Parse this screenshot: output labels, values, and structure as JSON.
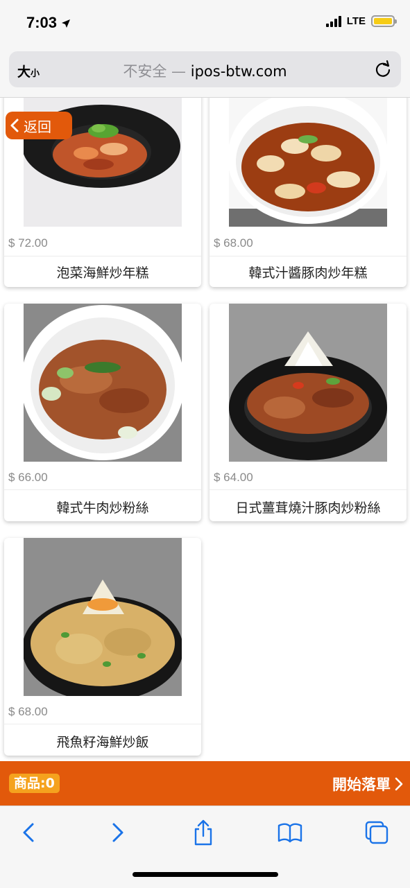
{
  "status": {
    "time": "7:03",
    "network": "LTE"
  },
  "browser": {
    "text_size_label": "大",
    "text_size_small": "小",
    "security_label": "不安全",
    "separator": " — ",
    "domain": "ipos-btw.com"
  },
  "back_button": {
    "label": "返回"
  },
  "products": [
    {
      "price": "$ 72.00",
      "name": "泡菜海鮮炒年糕"
    },
    {
      "price": "$ 68.00",
      "name": "韓式汁醬豚肉炒年糕"
    },
    {
      "price": "$ 66.00",
      "name": "韓式牛肉炒粉絲"
    },
    {
      "price": "$ 64.00",
      "name": "日式薑茸燒汁豚肉炒粉絲"
    },
    {
      "price": "$ 68.00",
      "name": "飛魚籽海鮮炒飯"
    }
  ],
  "order_bar": {
    "count_label": "商品:",
    "count_value": "0",
    "checkout_label": "開始落單"
  },
  "colors": {
    "accent": "#e2590b",
    "badge": "#f5a21e",
    "ios_blue": "#1a73e8"
  }
}
